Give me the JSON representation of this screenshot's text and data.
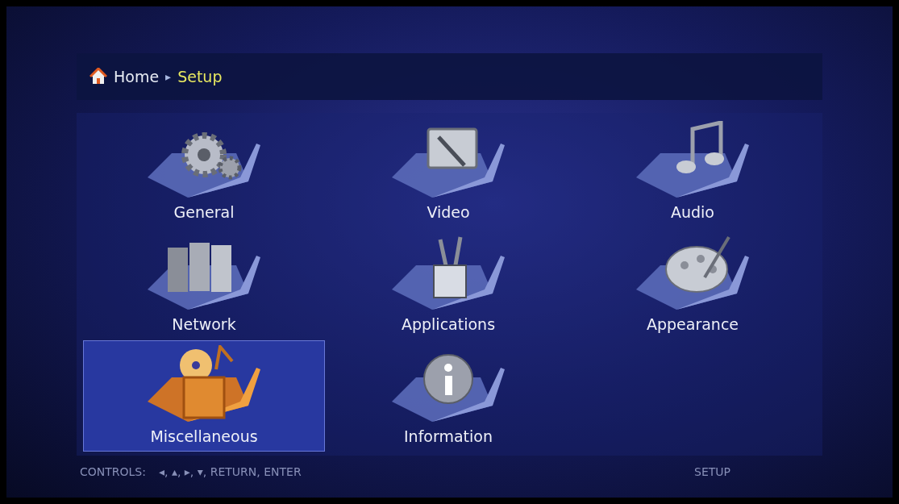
{
  "breadcrumb": {
    "home": "Home",
    "separator": "▸",
    "current": "Setup"
  },
  "menu": [
    {
      "label": "General",
      "selected": false
    },
    {
      "label": "Video",
      "selected": false
    },
    {
      "label": "Audio",
      "selected": false
    },
    {
      "label": "Network",
      "selected": false
    },
    {
      "label": "Applications",
      "selected": false
    },
    {
      "label": "Appearance",
      "selected": false
    },
    {
      "label": "Miscellaneous",
      "selected": true
    },
    {
      "label": "Information",
      "selected": false
    }
  ],
  "footer": {
    "controls_label": "CONTROLS:",
    "controls_keys": "◂, ▴, ▸, ▾, RETURN, ENTER",
    "section": "SETUP"
  }
}
